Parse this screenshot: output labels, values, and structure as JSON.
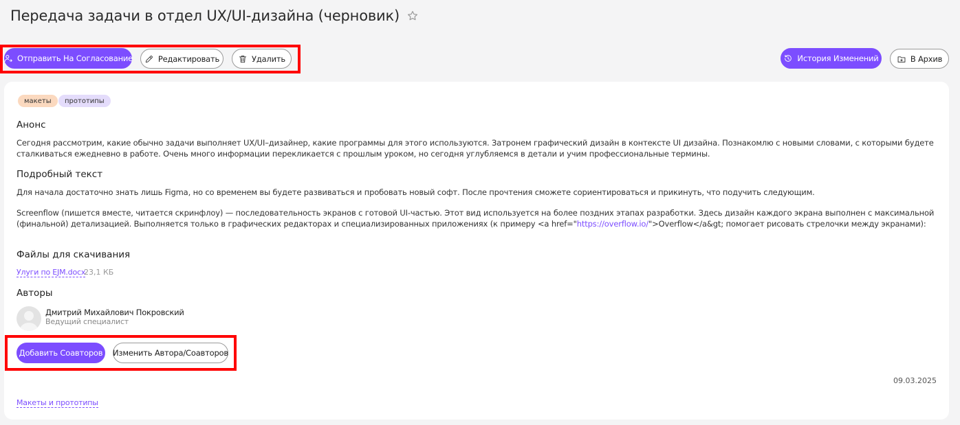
{
  "page": {
    "title": "Передача задачи в отдел UX/UI-дизайна (черновик)"
  },
  "toolbar": {
    "send_approval_label": "Отправить На Согласование",
    "edit_label": "Редактировать",
    "delete_label": "Удалить",
    "history_label": "История Изменений",
    "archive_label": "В Архив"
  },
  "tags": [
    "макеты",
    "прототипы"
  ],
  "announce": {
    "heading": "Анонс",
    "text": "Сегодня рассмотрим, какие обычно задачи выполняет UX/UI–дизайнер, какие программы для этого используются. Затронем графический дизайн в контексте UI дизайна. Познакомлю с новыми словами, с которыми будете сталкиваться ежедневно в работе. Очень много информации перекликается с прошлым уроком, но сегодня углубляемся в детали и учим профессиональные термины."
  },
  "detail": {
    "heading": "Подробный текст",
    "paragraph1": "Для начала достаточно знать лишь Figma, но со временем вы будете развиваться и пробовать новый софт. После прочтения сможете сориентироваться и прикинуть, что подучить следующим.",
    "paragraph2_before": "Screenflow (пишется вместе, читается скринфлоу) — последовательность экранов с готовой UI-частью. Этот вид используется на более поздних этапах разработки. Здесь дизайн каждого экрана выполнен с максимальной (финальной) детализацией. Выполняется только в графических редакторах и специализированных приложениях (к примеру <a href=\"",
    "paragraph2_link": "https://overflow.io/",
    "paragraph2_after": "\">Overflow</a&gt; помогает рисовать стрелочки между экранами):"
  },
  "files": {
    "heading": "Файлы для скачивания",
    "items": [
      {
        "name": "Улуги по EJM.docx",
        "size": "23,1 КБ"
      }
    ]
  },
  "authors": {
    "heading": "Авторы",
    "items": [
      {
        "name": "Дмитрий Михайлович Покровский",
        "role": "Ведущий специалист"
      }
    ],
    "add_coauthors_label": "Добавить Соавторов",
    "change_authors_label": "Изменить Автора/Соавторов"
  },
  "footer": {
    "date": "09.03.2025",
    "category_link": "Макеты и прототипы"
  },
  "colors": {
    "accent": "#7c4dff",
    "highlight": "#ff0000",
    "tag_orange": "#fbd9bf",
    "tag_purple": "#e4dcfb"
  },
  "icons": [
    "star-icon",
    "send-user-icon",
    "pencil-icon",
    "trash-icon",
    "history-icon",
    "archive-icon"
  ]
}
